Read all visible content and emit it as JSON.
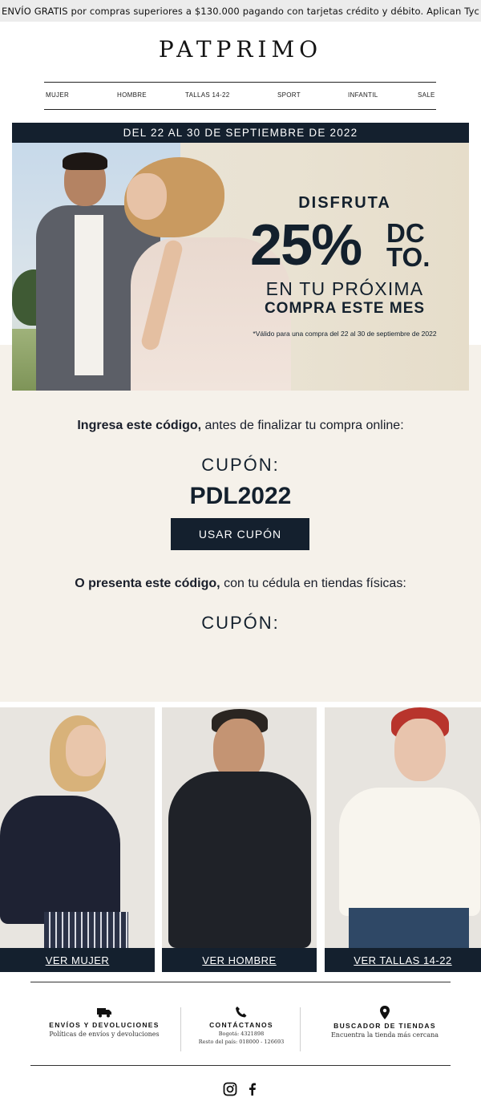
{
  "top_banner": "ENVÍO GRATIS por compras superiores a $130.000 pagando con tarjetas crédito y débito. Aplican Tyc",
  "brand": "PATPRIMO",
  "nav": [
    "MUJER",
    "HOMBRE",
    "TALLAS 14-22",
    "SPORT",
    "INFANTIL",
    "SALE"
  ],
  "date_range": "DEL 22 AL 30 DE SEPTIEMBRE DE 2022",
  "promo": {
    "enjoy": "DISFRUTA",
    "percent": "25%",
    "dcto_line1": "DC",
    "dcto_line2": "TO.",
    "next": "EN TU PRÓXIMA",
    "month": "COMPRA ESTE MES",
    "valid": "*Válido para una compra del 22 al 30 de septiembre de 2022"
  },
  "online": {
    "bold": "Ingresa este código,",
    "rest": " antes de finalizar tu compra online:"
  },
  "coupon_label": "CUPÓN:",
  "coupon_code": "PDL2022",
  "use_coupon": "USAR CUPÓN",
  "stores": {
    "bold": "O presenta este código,",
    "rest": " con tu cédula en tiendas físicas:"
  },
  "coupon_label_2": "CUPÓN:",
  "cards": [
    {
      "label": "VER MUJER"
    },
    {
      "label": "VER HOMBRE"
    },
    {
      "label": "VER TALLAS 14-22"
    }
  ],
  "footer": {
    "shipping": {
      "icon": "truck-icon",
      "title": "ENVÍOS Y DEVOLUCIONES",
      "sub": "Políticas de envíos y devoluciones"
    },
    "contact": {
      "icon": "phone-icon",
      "title": "CONTÁCTANOS",
      "line1": "Bogotá: 4321898",
      "line2": "Resto del país: 018000 - 126693"
    },
    "stores": {
      "icon": "location-pin-icon",
      "title": "BUSCADOR DE TIENDAS",
      "sub": "Encuentra la tienda más cercana"
    }
  },
  "social": [
    "instagram-icon",
    "facebook-icon"
  ],
  "colors": {
    "navy": "#14202e",
    "beige": "#f5f1ea",
    "top_bar": "#ececec"
  }
}
